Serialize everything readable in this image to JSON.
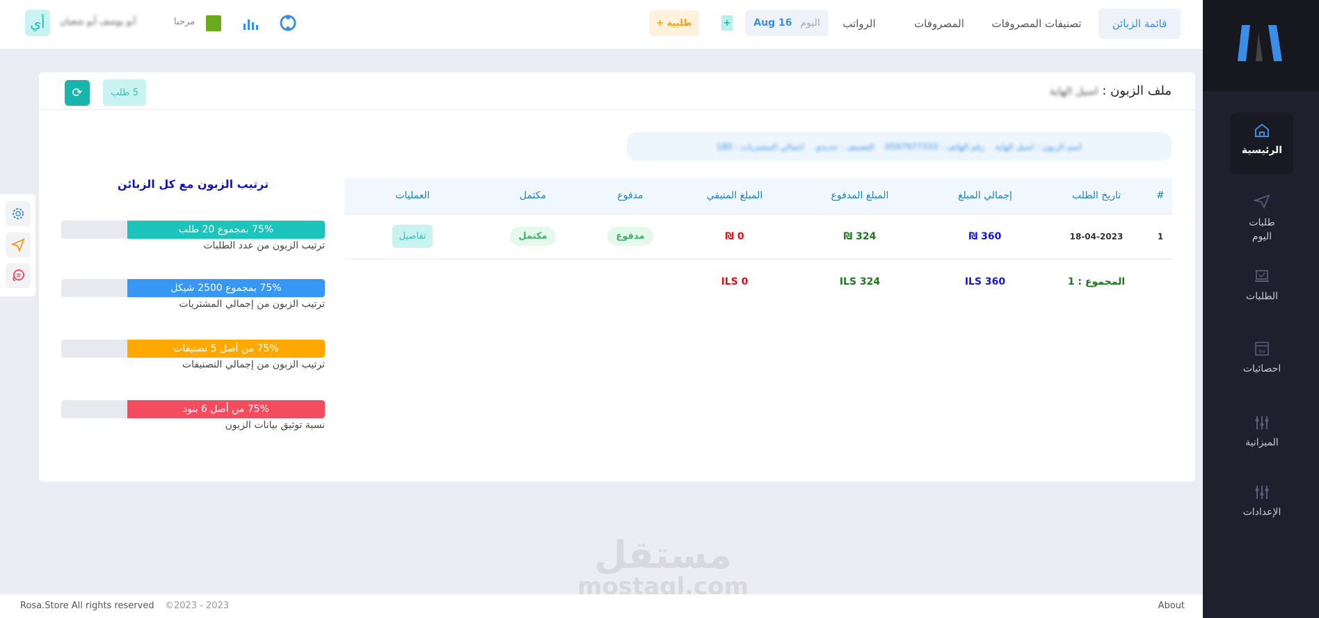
{
  "topbar": {
    "avatar_initials": "أي",
    "welcome": "مرحبا",
    "username": "أبو يوسف أبو شعبان",
    "new_order": "طلبية +",
    "today_label": "اليوم",
    "today_date": "Aug 16",
    "nav": [
      "قائمة الزبائن",
      "تصنيفات المصروفات",
      "المصروفات",
      "الرواتب"
    ]
  },
  "sidebar": {
    "items": [
      {
        "label": "الرئيسية",
        "icon": "home-icon"
      },
      {
        "label": "طلبات اليوم",
        "icon": "send-icon"
      },
      {
        "label": "الطلبات",
        "icon": "laptop-check-icon"
      },
      {
        "label": "احصائيات",
        "icon": "stats-window-icon"
      },
      {
        "label": "الميزانية",
        "icon": "sliders-icon"
      },
      {
        "label": "الإعدادات",
        "icon": "sliders-icon"
      }
    ]
  },
  "card": {
    "title": "ملف الزبون :",
    "customer_name": "اسيل الهاية",
    "orders_badge": "5 طلب",
    "info_line": "اسم الزبون : اسيل الهاية    رقم الهاتف : 0597977333    التصنيف : جديدي    اجمالي المشتريات : 180"
  },
  "table": {
    "headers": [
      "#",
      "تاريخ الطلب",
      "إجمالي المبلغ",
      "المبلغ المدفوع",
      "المبلغ المتبقي",
      "مدفوع",
      "مكتمل",
      "العمليات"
    ],
    "rows": [
      {
        "num": "1",
        "date": "18-04-2023",
        "total": "360 ₪",
        "paid": "324 ₪",
        "remaining": "0 ₪",
        "paid_status": "مدفوع",
        "complete_status": "مكتمل",
        "action": "تفاصيل"
      }
    ],
    "totals": {
      "label": "المجموع : 1",
      "total": "ILS 360",
      "paid": "ILS 324",
      "remaining": "ILS 0"
    }
  },
  "ranking": {
    "title": "ترتيب الزبون مع كل الزبائن",
    "bars": [
      {
        "text": "75% بمجموع 20 طلب",
        "label": "ترتيب الزبون من عدد الطلبات",
        "percent": 75,
        "color": "#1dc4bb"
      },
      {
        "text": "75% بمجموع 2500 شيكل",
        "label": "ترتيب الزبون من إجمالي المشتريات",
        "percent": 75,
        "color": "#3896f5"
      },
      {
        "text": "75% من أصل 5 تصنيفات",
        "label": "ترتيب الزبون من إجمالي التصنيفات",
        "percent": 75,
        "color": "#ffa800"
      },
      {
        "text": "75% من أصل 6 بنود",
        "label": "نسبة توثيق بيانات الزبون",
        "percent": 75,
        "color": "#f34c5f"
      }
    ]
  },
  "footer": {
    "brand": "Rosa.Store All rights reserved",
    "years": "©2023 - 2023",
    "about": "About"
  },
  "watermark": {
    "arabic": "مستقل",
    "latin": "mostaql.com"
  }
}
